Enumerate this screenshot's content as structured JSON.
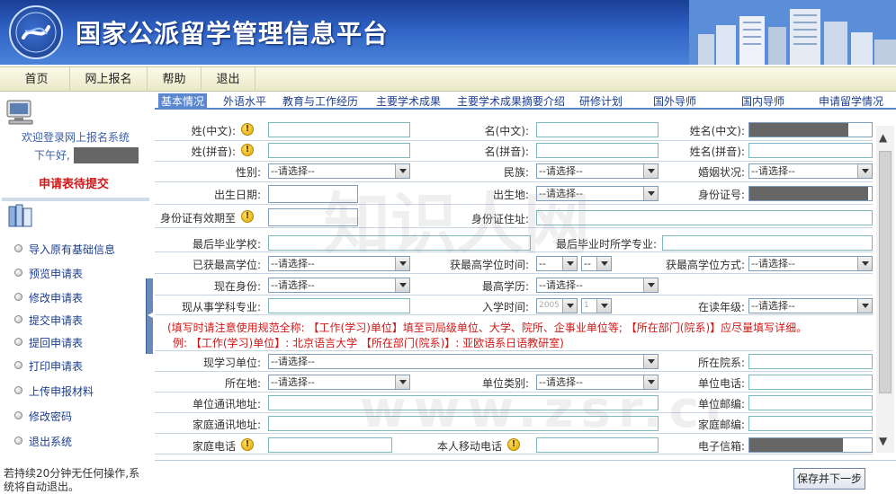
{
  "header": {
    "title": "国家公派留学管理信息平台",
    "logo_icon": "csc-seal-logo",
    "colors": {
      "bar_top": "#1a3f95",
      "bar_bottom": "#4a84d8"
    }
  },
  "menu": {
    "items": [
      {
        "label": "首页"
      },
      {
        "label": "网上报名"
      },
      {
        "label": "帮助"
      },
      {
        "label": "退出"
      }
    ]
  },
  "sidebar": {
    "welcome": "欢迎登录网上报名系统",
    "greeting": "下午好,",
    "status": "申请表待提交",
    "nav": [
      {
        "label": "导入原有基础信息"
      },
      {
        "label": "预览申请表"
      },
      {
        "label": "修改申请表"
      },
      {
        "label": "提交申请表"
      },
      {
        "label": "提回申请表"
      },
      {
        "label": "打印申请表"
      },
      {
        "label": "上传申报材料"
      },
      {
        "label": "修改密码"
      },
      {
        "label": "退出系统"
      }
    ],
    "notice": "若持续20分钟无任何操作,系统将自动退出。"
  },
  "tabs": [
    {
      "label": "基本情况",
      "active": true
    },
    {
      "label": "外语水平"
    },
    {
      "label": "教育与工作经历"
    },
    {
      "label": "主要学术成果"
    },
    {
      "label": "主要学术成果摘要介绍"
    },
    {
      "label": "研修计划"
    },
    {
      "label": "国外导师"
    },
    {
      "label": "国内导师"
    },
    {
      "label": "申请留学情况"
    }
  ],
  "form": {
    "select_placeholder": "--请选择--",
    "labels": {
      "name_cn": "姓(中文):",
      "given_cn": "名(中文):",
      "fullname_cn": "姓名(中文):",
      "name_py": "姓(拼音):",
      "given_py": "名(拼音):",
      "fullname_py": "姓名(拼音):",
      "gender": "性别:",
      "ethnicity": "民族:",
      "marital": "婚姻状况:",
      "birth_date": "出生日期:",
      "birth_place": "出生地:",
      "id_number": "身份证号:",
      "id_valid": "身份证有效期至",
      "id_address": "身份证住址:",
      "last_school": "最后毕业学校:",
      "last_major": "最后毕业时所学专业:",
      "highest_degree": "已获最高学位:",
      "degree_time": "获最高学位时间:",
      "degree_method": "获最高学位方式:",
      "current_status": "现在身份:",
      "education": "最高学历:",
      "current_major": "现从事学科专业:",
      "enroll_time": "入学时间:",
      "study_year": "在读年级:",
      "unit": "现学习单位:",
      "department": "所在院系:",
      "location": "所在地:",
      "unit_type": "单位类别:",
      "unit_phone": "单位电话:",
      "unit_address": "单位通讯地址:",
      "unit_zip": "单位邮编:",
      "home_address": "家庭通讯地址:",
      "home_zip": "家庭邮编:",
      "home_phone": "家庭电话",
      "mobile": "本人移动电话",
      "email": "电子信箱:"
    },
    "notice_line1": "(填写时请注意使用规范全称: 【工作(学习)单位】填至司局级单位、大学、院所、企事业单位等; 【所在部门(院系)】应尽量填写详细。",
    "notice_line2": "例: 【工作(学习)单位】: 北京语言大学 【所在部门(院系)】: 亚欧语系日语教研室)",
    "enroll_year": "2005",
    "enroll_month": "1",
    "degree_time_value": "--",
    "degree_time_value2": "--"
  },
  "footer": {
    "save_label": "保存并下一步"
  },
  "watermark": {
    "line1": "知识人网",
    "line2": "www.zsr.cc"
  }
}
